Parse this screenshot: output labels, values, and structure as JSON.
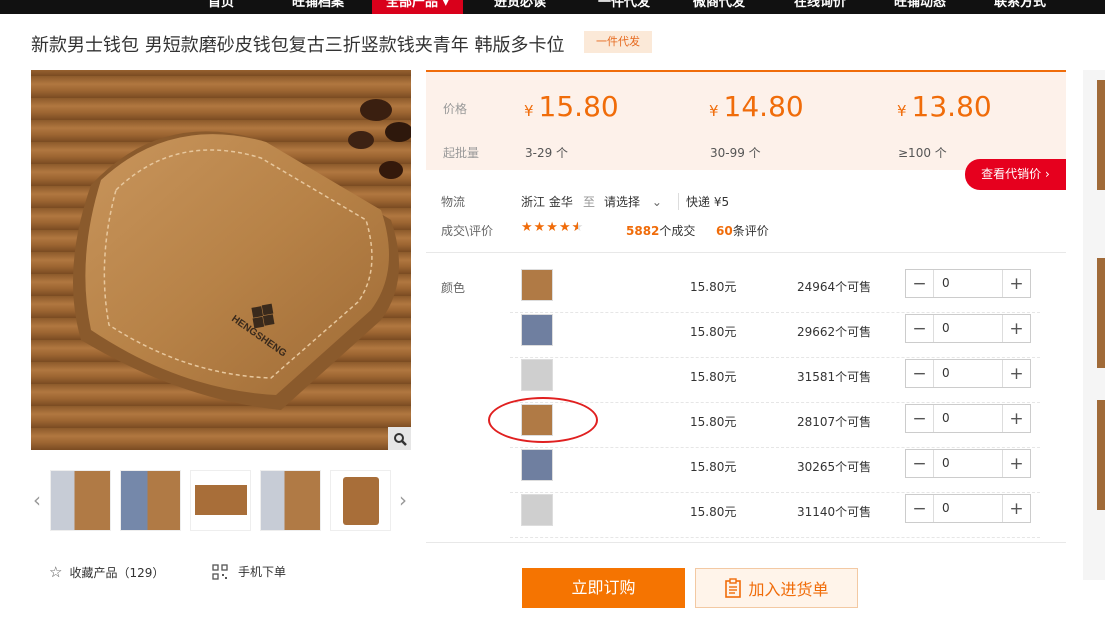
{
  "nav": {
    "items": [
      "首页",
      "旺铺档案",
      "全部产品",
      "进货必读",
      "一件代发",
      "微商代发",
      "在线询价",
      "旺铺动态",
      "联系方式"
    ],
    "active_index": 2
  },
  "product": {
    "title": "新款男士钱包 男短款磨砂皮钱包复古三折竖款钱夹青年 韩版多卡位",
    "badge": "一件代发",
    "image_brand_text": "HENGSHENG"
  },
  "price_box": {
    "price_label": "价格",
    "moq_label": "起批量",
    "currency": "¥",
    "tiers": [
      {
        "price": "15.80",
        "range": "3-29 个"
      },
      {
        "price": "14.80",
        "range": "30-99 个"
      },
      {
        "price": "13.80",
        "range": "≥100 个"
      }
    ],
    "agent_button": "查看代销价"
  },
  "logistics": {
    "label": "物流",
    "origin": "浙江 金华",
    "to": "至",
    "destination_placeholder": "请选择",
    "shipping": "快递 ¥5"
  },
  "deals": {
    "label": "成交\\评价",
    "rating": 4.5,
    "deal_count": "5882",
    "deal_unit": "个成交",
    "review_count": "60",
    "review_unit": "条评价"
  },
  "sku": {
    "label": "颜色",
    "rows": [
      {
        "price": "15.80元",
        "stock": "24964个可售",
        "qty": "0",
        "color": "#b07a45"
      },
      {
        "price": "15.80元",
        "stock": "29662个可售",
        "qty": "0",
        "color": "#6f7fa0"
      },
      {
        "price": "15.80元",
        "stock": "31581个可售",
        "qty": "0",
        "color": "#cfcfcf"
      },
      {
        "price": "15.80元",
        "stock": "28107个可售",
        "qty": "0",
        "color": "#b07a45"
      },
      {
        "price": "15.80元",
        "stock": "30265个可售",
        "qty": "0",
        "color": "#6f7fa0"
      },
      {
        "price": "15.80元",
        "stock": "31140个可售",
        "qty": "0",
        "color": "#cfcfcf"
      }
    ]
  },
  "actions": {
    "favorite_label": "收藏产品（129）",
    "mobile_label": "手机下单",
    "order_button": "立即订购",
    "cart_button": "加入进货单"
  },
  "colors": {
    "accent": "#f06c0a",
    "nav_active": "#d9001b",
    "agent_button": "#e6001e",
    "highlight_circle": "#e02020"
  }
}
